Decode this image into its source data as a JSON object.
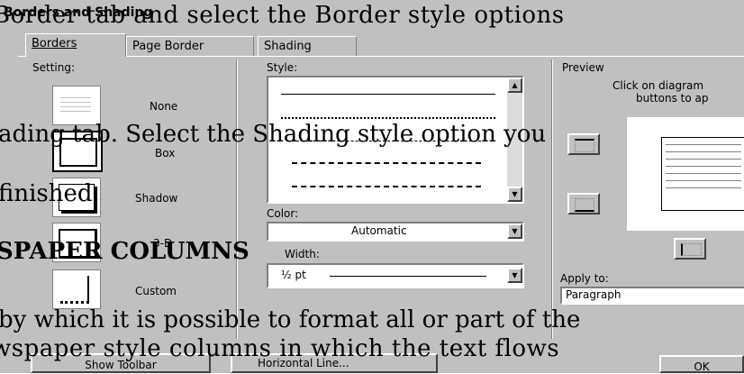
{
  "doc": {
    "line1": "Border tab and select the Border style options",
    "line2": "ading tab. Select the Shading style option you",
    "line3": "finished.",
    "line4": "SPAPER COLUMNS",
    "line5": "by which it is possible to format all or part of the",
    "line6": "wspaper style columns in which the text flows"
  },
  "dialog": {
    "title": "Borders and Shading",
    "tabs": [
      "Borders",
      "Page Border",
      "Shading"
    ],
    "setting_label": "Setting:",
    "settings": [
      "None",
      "Box",
      "Shadow",
      "3-D",
      "Custom"
    ],
    "style_label": "Style:",
    "color_label": "Color:",
    "color_value": "Automatic",
    "width_label": "Width:",
    "width_value": "½ pt",
    "preview_label": "Preview",
    "preview_hint_1": "Click on diagram",
    "preview_hint_2": "buttons to ap",
    "apply_label": "Apply to:",
    "apply_value": "Paragraph",
    "show_toolbar": "Show Toolbar",
    "horizontal_line": "Horizontal Line...",
    "ok": "OK"
  }
}
